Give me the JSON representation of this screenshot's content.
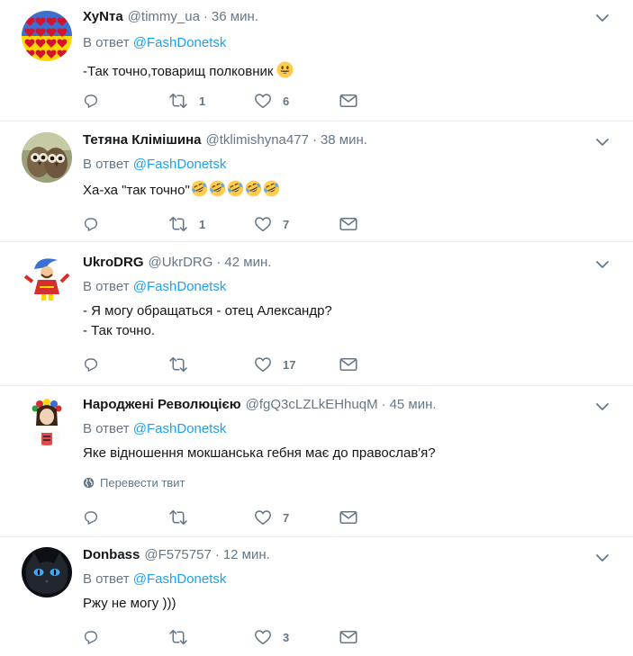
{
  "colors": {
    "link": "#1da1f2",
    "muted": "#657786",
    "text": "#14171a",
    "border": "#e6ecf0"
  },
  "icons": [
    "reply-icon",
    "retweet-icon",
    "heart-icon",
    "dm-icon",
    "chevron-down-icon",
    "globe-icon"
  ],
  "tweets": [
    {
      "name": "ХуNта",
      "handle": "@timmy_ua",
      "sep": "·",
      "time": "36 мин.",
      "reply_prefix": "В ответ",
      "reply_to": "@FashDonetsk",
      "text_lines": [
        "-Так точно,товарищ полковник"
      ],
      "emojis": [
        "smiley-emoji"
      ],
      "retweets": "1",
      "likes": "6"
    },
    {
      "name": "Тетяна Клімішина",
      "handle": "@tklimishyna477",
      "sep": "·",
      "time": "38 мин.",
      "reply_prefix": "В ответ",
      "reply_to": "@FashDonetsk",
      "text_lines": [
        "Ха-ха \"так точно\""
      ],
      "emojis": [
        "rofl-emoji",
        "rofl-emoji",
        "rofl-emoji",
        "rofl-emoji",
        "rofl-emoji"
      ],
      "retweets": "1",
      "likes": "7"
    },
    {
      "name": "UkroDRG",
      "handle": "@UkrDRG",
      "sep": "·",
      "time": "42 мин.",
      "reply_prefix": "В ответ",
      "reply_to": "@FashDonetsk",
      "text_lines": [
        "- Я могу обращаться - отец Александр?",
        "- Так точно."
      ],
      "retweets": "",
      "likes": "17"
    },
    {
      "name": "Народжені Революцією",
      "handle": "@fgQ3cLZLkEHhuqM",
      "sep": "·",
      "time": "45 мин.",
      "reply_prefix": "В ответ",
      "reply_to": "@FashDonetsk",
      "text_lines": [
        "Яке відношення мокшанська гебня має до православ'я?"
      ],
      "translate": "Перевести твит",
      "retweets": "",
      "likes": "7"
    },
    {
      "name": "Donbass",
      "handle": "@F575757",
      "sep": "·",
      "time": "12 мин.",
      "reply_prefix": "В ответ",
      "reply_to": "@FashDonetsk",
      "text_lines": [
        "Ржу не могу )))"
      ],
      "retweets": "",
      "likes": "3"
    }
  ]
}
